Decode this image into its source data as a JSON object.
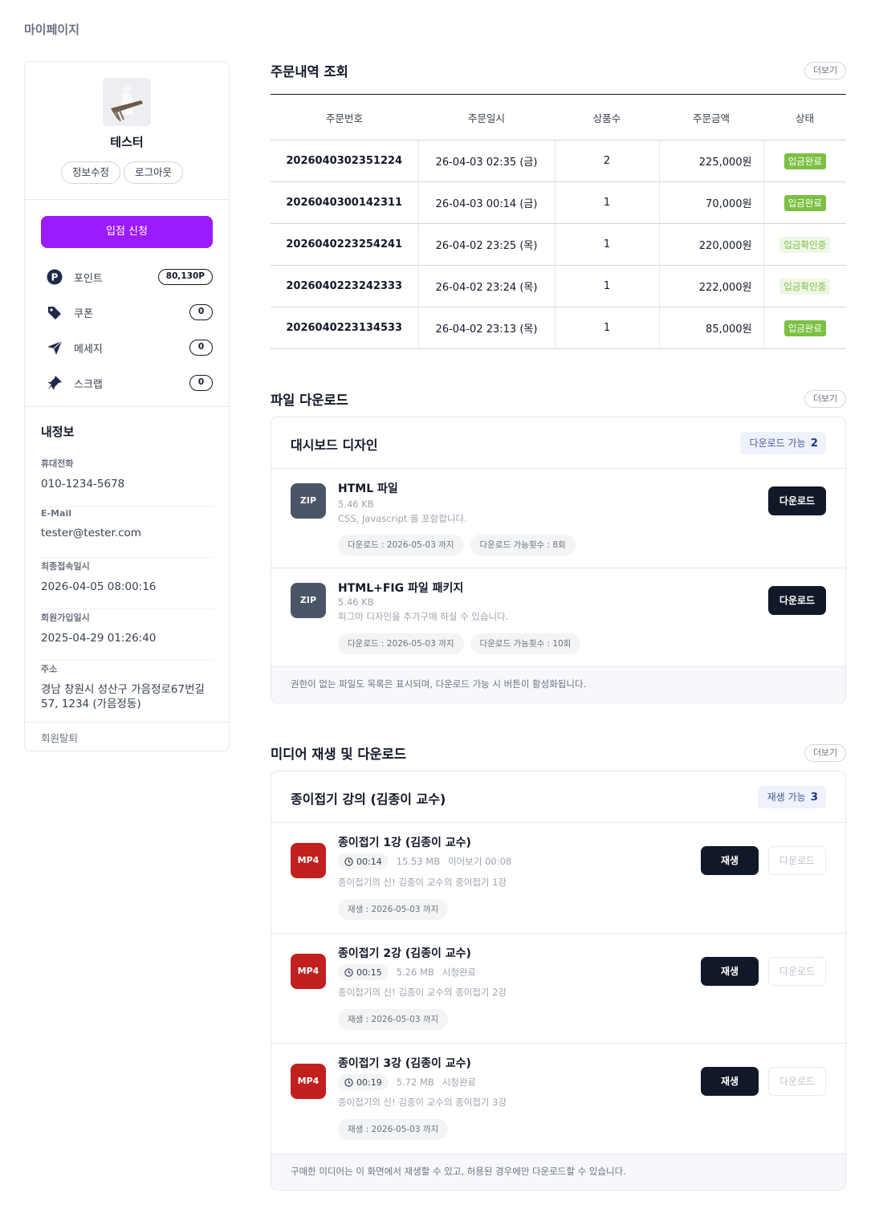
{
  "page": {
    "label": "마이페이지"
  },
  "profile": {
    "name": "테스터",
    "edit_label": "정보수정",
    "logout_label": "로그아웃"
  },
  "sidebar": {
    "apply_label": "입점 신청",
    "menu": [
      {
        "label": "포인트",
        "count": "80,130P",
        "icon": "point-icon"
      },
      {
        "label": "쿠폰",
        "count": "0",
        "icon": "coupon-icon"
      },
      {
        "label": "메세지",
        "count": "0",
        "icon": "message-icon"
      },
      {
        "label": "스크랩",
        "count": "0",
        "icon": "scrap-icon"
      }
    ],
    "info_title": "내정보",
    "info": [
      {
        "label": "휴대전화",
        "value": "010-1234-5678"
      },
      {
        "label": "E-Mail",
        "value": "tester@tester.com"
      },
      {
        "label": "최종접속일시",
        "value": "2026-04-05 08:00:16"
      },
      {
        "label": "회원가입일시",
        "value": "2025-04-29 01:26:40"
      },
      {
        "label": "주소",
        "value": "경남 창원시 성산구 가음정로67번길 57, 1234 (가음정동)"
      }
    ],
    "withdraw_label": "회원탈퇴"
  },
  "orders": {
    "title": "주문내역 조회",
    "more_label": "더보기",
    "columns": [
      "주문번호",
      "주문일시",
      "상품수",
      "주문금액",
      "상태"
    ],
    "rows": [
      {
        "no": "2026040302351224",
        "date": "26-04-03 02:35 (금)",
        "qty": "2",
        "amount": "225,000원",
        "status": "입금완료",
        "done": true
      },
      {
        "no": "2026040300142311",
        "date": "26-04-03 00:14 (금)",
        "qty": "1",
        "amount": "70,000원",
        "status": "입금완료",
        "done": true
      },
      {
        "no": "2026040223254241",
        "date": "26-04-02 23:25 (목)",
        "qty": "1",
        "amount": "220,000원",
        "status": "입금확인중",
        "done": false
      },
      {
        "no": "2026040223242333",
        "date": "26-04-02 23:24 (목)",
        "qty": "1",
        "amount": "222,000원",
        "status": "입금확인중",
        "done": false
      },
      {
        "no": "2026040223134533",
        "date": "26-04-02 23:13 (목)",
        "qty": "1",
        "amount": "85,000원",
        "status": "입금완료",
        "done": true
      }
    ]
  },
  "files": {
    "title": "파일 다운로드",
    "more_label": "더보기",
    "card_title": "대시보드 디자인",
    "badge_label": "다운로드 가능",
    "badge_count": "2",
    "items": [
      {
        "type": "ZIP",
        "name": "HTML 파일",
        "size": "5.46 KB",
        "desc": "CSS, Javascript 를 포함합니다.",
        "tag1": "다운로드 : 2026-05-03 까지",
        "tag2": "다운로드 가능횟수 : 8회",
        "button": "다운로드"
      },
      {
        "type": "ZIP",
        "name": "HTML+FIG 파일 패키지",
        "size": "5.46 KB",
        "desc": "피그마 디자인을 추가구매 하실 수 있습니다.",
        "tag1": "다운로드 : 2026-05-03 까지",
        "tag2": "다운로드 가능횟수 : 10회",
        "button": "다운로드"
      }
    ],
    "footer": "권한이 없는 파일도 목록은 표시되며, 다운로드 가능 시 버튼이 활성화됩니다."
  },
  "media": {
    "title": "미디어 재생 및 다운로드",
    "more_label": "더보기",
    "card_title": "종이접기 강의 (김종이 교수)",
    "badge_label": "재생 가능",
    "badge_count": "3",
    "items": [
      {
        "type": "MP4",
        "name": "종이접기 1강 (김종이 교수)",
        "duration": "00:14",
        "size": "15.53 MB",
        "state": "이어보기 00:08",
        "desc": "종이접기의 신! 김종이 교수의 종이접기 1강",
        "tag": "재생 : 2026-05-03 까지",
        "play": "재생",
        "download": "다운로드"
      },
      {
        "type": "MP4",
        "name": "종이접기 2강 (김종이 교수)",
        "duration": "00:15",
        "size": "5.26 MB",
        "state": "시청완료",
        "desc": "종이접기의 신! 김종이 교수의 종이접기 2강",
        "tag": "재생 : 2026-05-03 까지",
        "play": "재생",
        "download": "다운로드"
      },
      {
        "type": "MP4",
        "name": "종이접기 3강 (김종이 교수)",
        "duration": "00:19",
        "size": "5.72 MB",
        "state": "시청완료",
        "desc": "종이접기의 신! 김종이 교수의 종이접기 3강",
        "tag": "재생 : 2026-05-03 까지",
        "play": "재생",
        "download": "다운로드"
      }
    ],
    "footer": "구매한 미디어는 이 화면에서 재생할 수 있고, 허용된 경우에만 다운로드할 수 있습니다."
  },
  "colors": {
    "accent": "#9b1bff",
    "status_done": "#7cc042",
    "dark_button": "#111827",
    "mp4": "#c1201f",
    "zip": "#4a5568"
  }
}
